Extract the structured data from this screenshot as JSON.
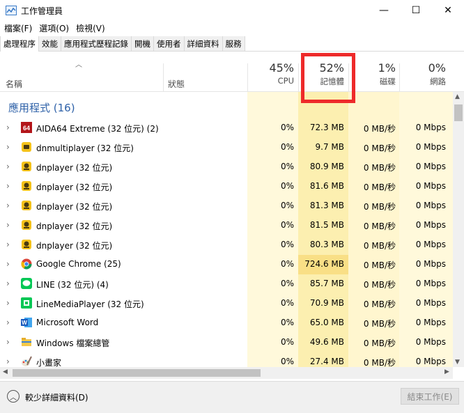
{
  "window": {
    "title": "工作管理員",
    "minimize": "—",
    "maximize": "☐",
    "close": "✕"
  },
  "menu": [
    {
      "label": "檔案(F)"
    },
    {
      "label": "選項(O)"
    },
    {
      "label": "檢視(V)"
    }
  ],
  "tabs": [
    {
      "label": "處理程序",
      "active": true
    },
    {
      "label": "效能"
    },
    {
      "label": "應用程式歷程記錄"
    },
    {
      "label": "開機"
    },
    {
      "label": "使用者"
    },
    {
      "label": "詳細資料"
    },
    {
      "label": "服務"
    }
  ],
  "columns": {
    "name": "名稱",
    "status": "狀態",
    "cpu": {
      "pct": "45%",
      "label": "CPU"
    },
    "memory": {
      "pct": "52%",
      "label": "記憶體"
    },
    "disk": {
      "pct": "1%",
      "label": "磁碟"
    },
    "network": {
      "pct": "0%",
      "label": "網路"
    }
  },
  "section": {
    "label": "應用程式 (16)"
  },
  "processes": [
    {
      "name": "AIDA64 Extreme (32 位元) (2)",
      "cpu": "0%",
      "memory": "72.3 MB",
      "disk": "0 MB/秒",
      "network": "0 Mbps",
      "icon": "aida64-icon"
    },
    {
      "name": "dnmultiplayer (32 位元)",
      "cpu": "0%",
      "memory": "9.7 MB",
      "disk": "0 MB/秒",
      "network": "0 Mbps",
      "icon": "dnmultiplayer-icon"
    },
    {
      "name": "dnplayer (32 位元)",
      "cpu": "0%",
      "memory": "80.9 MB",
      "disk": "0 MB/秒",
      "network": "0 Mbps",
      "icon": "dnplayer-icon"
    },
    {
      "name": "dnplayer (32 位元)",
      "cpu": "0%",
      "memory": "81.6 MB",
      "disk": "0 MB/秒",
      "network": "0 Mbps",
      "icon": "dnplayer-icon"
    },
    {
      "name": "dnplayer (32 位元)",
      "cpu": "0%",
      "memory": "81.3 MB",
      "disk": "0 MB/秒",
      "network": "0 Mbps",
      "icon": "dnplayer-icon"
    },
    {
      "name": "dnplayer (32 位元)",
      "cpu": "0%",
      "memory": "81.5 MB",
      "disk": "0 MB/秒",
      "network": "0 Mbps",
      "icon": "dnplayer-icon"
    },
    {
      "name": "dnplayer (32 位元)",
      "cpu": "0%",
      "memory": "80.3 MB",
      "disk": "0 MB/秒",
      "network": "0 Mbps",
      "icon": "dnplayer-icon"
    },
    {
      "name": "Google Chrome (25)",
      "cpu": "0%",
      "memory": "724.6 MB",
      "disk": "0 MB/秒",
      "network": "0 Mbps",
      "icon": "chrome-icon",
      "mem_hot": true
    },
    {
      "name": "LINE (32 位元) (4)",
      "cpu": "0%",
      "memory": "85.7 MB",
      "disk": "0 MB/秒",
      "network": "0 Mbps",
      "icon": "line-icon"
    },
    {
      "name": "LineMediaPlayer (32 位元)",
      "cpu": "0%",
      "memory": "70.9 MB",
      "disk": "0 MB/秒",
      "network": "0 Mbps",
      "icon": "linemediaplayer-icon"
    },
    {
      "name": "Microsoft Word",
      "cpu": "0%",
      "memory": "65.0 MB",
      "disk": "0 MB/秒",
      "network": "0 Mbps",
      "icon": "word-icon"
    },
    {
      "name": "Windows 檔案總管",
      "cpu": "0%",
      "memory": "49.6 MB",
      "disk": "0 MB/秒",
      "network": "0 Mbps",
      "icon": "explorer-icon"
    },
    {
      "name": "小畫家",
      "cpu": "0%",
      "memory": "27.4 MB",
      "disk": "0 MB/秒",
      "network": "0 Mbps",
      "icon": "paint-icon"
    }
  ],
  "colors": {
    "cpu_col": "#fff9db",
    "mem_col": "#fcefb0",
    "mem_hot": "#f9df86",
    "disk_col": "#fff6cf",
    "net_col": "#fff9db",
    "highlight": "#ee2a2a",
    "section": "#2e61a8"
  },
  "footer": {
    "fewer_details": "較少詳細資料(D)",
    "end_task": "結束工作(E)"
  }
}
